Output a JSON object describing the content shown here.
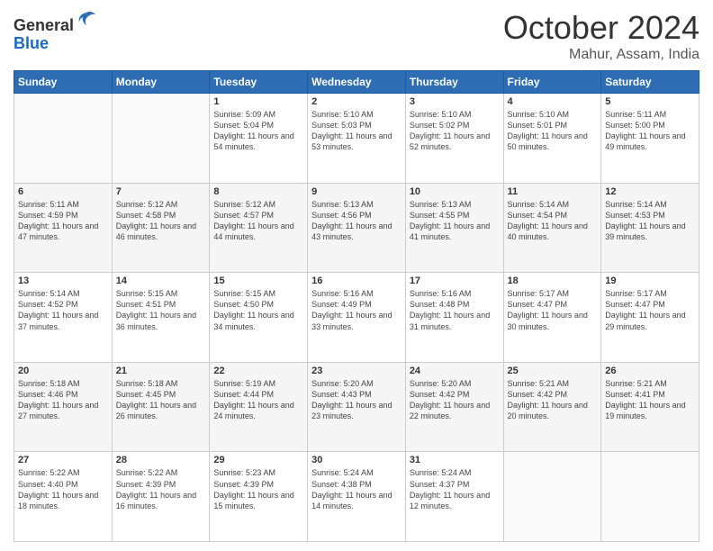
{
  "header": {
    "logo_general": "General",
    "logo_blue": "Blue",
    "month": "October 2024",
    "location": "Mahur, Assam, India"
  },
  "days_of_week": [
    "Sunday",
    "Monday",
    "Tuesday",
    "Wednesday",
    "Thursday",
    "Friday",
    "Saturday"
  ],
  "weeks": [
    [
      {
        "day": "",
        "content": ""
      },
      {
        "day": "",
        "content": ""
      },
      {
        "day": "1",
        "content": "Sunrise: 5:09 AM\nSunset: 5:04 PM\nDaylight: 11 hours and 54 minutes."
      },
      {
        "day": "2",
        "content": "Sunrise: 5:10 AM\nSunset: 5:03 PM\nDaylight: 11 hours and 53 minutes."
      },
      {
        "day": "3",
        "content": "Sunrise: 5:10 AM\nSunset: 5:02 PM\nDaylight: 11 hours and 52 minutes."
      },
      {
        "day": "4",
        "content": "Sunrise: 5:10 AM\nSunset: 5:01 PM\nDaylight: 11 hours and 50 minutes."
      },
      {
        "day": "5",
        "content": "Sunrise: 5:11 AM\nSunset: 5:00 PM\nDaylight: 11 hours and 49 minutes."
      }
    ],
    [
      {
        "day": "6",
        "content": "Sunrise: 5:11 AM\nSunset: 4:59 PM\nDaylight: 11 hours and 47 minutes."
      },
      {
        "day": "7",
        "content": "Sunrise: 5:12 AM\nSunset: 4:58 PM\nDaylight: 11 hours and 46 minutes."
      },
      {
        "day": "8",
        "content": "Sunrise: 5:12 AM\nSunset: 4:57 PM\nDaylight: 11 hours and 44 minutes."
      },
      {
        "day": "9",
        "content": "Sunrise: 5:13 AM\nSunset: 4:56 PM\nDaylight: 11 hours and 43 minutes."
      },
      {
        "day": "10",
        "content": "Sunrise: 5:13 AM\nSunset: 4:55 PM\nDaylight: 11 hours and 41 minutes."
      },
      {
        "day": "11",
        "content": "Sunrise: 5:14 AM\nSunset: 4:54 PM\nDaylight: 11 hours and 40 minutes."
      },
      {
        "day": "12",
        "content": "Sunrise: 5:14 AM\nSunset: 4:53 PM\nDaylight: 11 hours and 39 minutes."
      }
    ],
    [
      {
        "day": "13",
        "content": "Sunrise: 5:14 AM\nSunset: 4:52 PM\nDaylight: 11 hours and 37 minutes."
      },
      {
        "day": "14",
        "content": "Sunrise: 5:15 AM\nSunset: 4:51 PM\nDaylight: 11 hours and 36 minutes."
      },
      {
        "day": "15",
        "content": "Sunrise: 5:15 AM\nSunset: 4:50 PM\nDaylight: 11 hours and 34 minutes."
      },
      {
        "day": "16",
        "content": "Sunrise: 5:16 AM\nSunset: 4:49 PM\nDaylight: 11 hours and 33 minutes."
      },
      {
        "day": "17",
        "content": "Sunrise: 5:16 AM\nSunset: 4:48 PM\nDaylight: 11 hours and 31 minutes."
      },
      {
        "day": "18",
        "content": "Sunrise: 5:17 AM\nSunset: 4:47 PM\nDaylight: 11 hours and 30 minutes."
      },
      {
        "day": "19",
        "content": "Sunrise: 5:17 AM\nSunset: 4:47 PM\nDaylight: 11 hours and 29 minutes."
      }
    ],
    [
      {
        "day": "20",
        "content": "Sunrise: 5:18 AM\nSunset: 4:46 PM\nDaylight: 11 hours and 27 minutes."
      },
      {
        "day": "21",
        "content": "Sunrise: 5:18 AM\nSunset: 4:45 PM\nDaylight: 11 hours and 26 minutes."
      },
      {
        "day": "22",
        "content": "Sunrise: 5:19 AM\nSunset: 4:44 PM\nDaylight: 11 hours and 24 minutes."
      },
      {
        "day": "23",
        "content": "Sunrise: 5:20 AM\nSunset: 4:43 PM\nDaylight: 11 hours and 23 minutes."
      },
      {
        "day": "24",
        "content": "Sunrise: 5:20 AM\nSunset: 4:42 PM\nDaylight: 11 hours and 22 minutes."
      },
      {
        "day": "25",
        "content": "Sunrise: 5:21 AM\nSunset: 4:42 PM\nDaylight: 11 hours and 20 minutes."
      },
      {
        "day": "26",
        "content": "Sunrise: 5:21 AM\nSunset: 4:41 PM\nDaylight: 11 hours and 19 minutes."
      }
    ],
    [
      {
        "day": "27",
        "content": "Sunrise: 5:22 AM\nSunset: 4:40 PM\nDaylight: 11 hours and 18 minutes."
      },
      {
        "day": "28",
        "content": "Sunrise: 5:22 AM\nSunset: 4:39 PM\nDaylight: 11 hours and 16 minutes."
      },
      {
        "day": "29",
        "content": "Sunrise: 5:23 AM\nSunset: 4:39 PM\nDaylight: 11 hours and 15 minutes."
      },
      {
        "day": "30",
        "content": "Sunrise: 5:24 AM\nSunset: 4:38 PM\nDaylight: 11 hours and 14 minutes."
      },
      {
        "day": "31",
        "content": "Sunrise: 5:24 AM\nSunset: 4:37 PM\nDaylight: 11 hours and 12 minutes."
      },
      {
        "day": "",
        "content": ""
      },
      {
        "day": "",
        "content": ""
      }
    ]
  ]
}
